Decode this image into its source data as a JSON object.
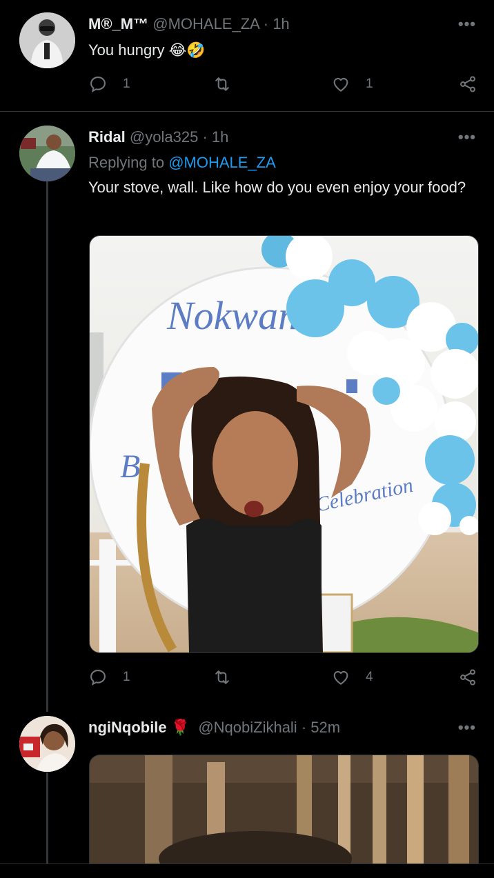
{
  "tweets": [
    {
      "name": "M®_M™",
      "handle": "@MOHALE_ZA",
      "time": "· 1h",
      "text": "You hungry 😂🤣",
      "replies": "1",
      "retweets": "",
      "likes": "1"
    },
    {
      "name": "Ridal",
      "handle": "@yola325",
      "time": "· 1h",
      "replying_prefix": "Replying to",
      "replying_to": "@MOHALE_ZA",
      "text": "Your stove, wall. Like how do you even enjoy your food?",
      "media": {
        "sign_word": "Nokwan",
        "sign_script": "Celebration",
        "sign_initial": "B"
      },
      "replies": "1",
      "retweets": "",
      "likes": "4"
    },
    {
      "name": "ngiNqobile",
      "emoji": "🌹",
      "handle": "@NqobiZikhali",
      "time": "· 52m"
    }
  ],
  "more_label": "•••",
  "colors": {
    "background": "#000000",
    "text": "#e7e9ea",
    "muted": "#71767b",
    "accent": "#1d9bf0",
    "divider": "#2f3336"
  },
  "icons": [
    "reply-icon",
    "retweet-icon",
    "like-icon",
    "share-icon",
    "more-icon"
  ]
}
